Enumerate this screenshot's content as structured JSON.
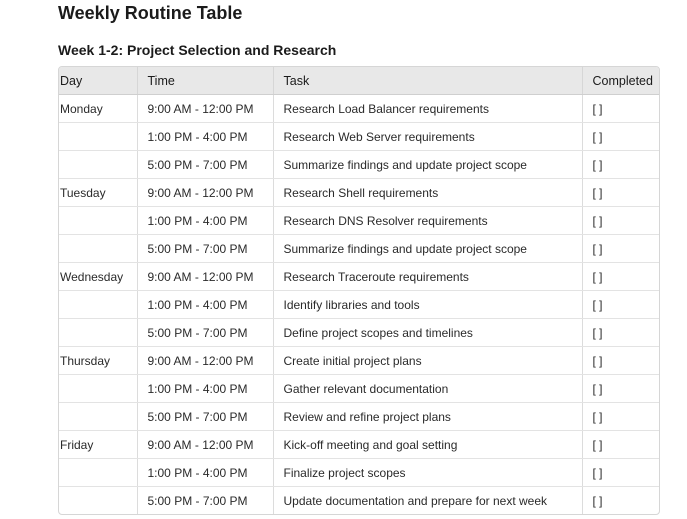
{
  "page": {
    "title": "Weekly Routine Table",
    "section_title": "Week 1-2: Project Selection and Research"
  },
  "table": {
    "headers": {
      "day": "Day",
      "time": "Time",
      "task": "Task",
      "completed": "Completed"
    },
    "rows": [
      {
        "day": "Monday",
        "time": "9:00 AM - 12:00 PM",
        "task": "Research Load Balancer requirements",
        "completed": "[ ]"
      },
      {
        "day": "",
        "time": "1:00 PM - 4:00 PM",
        "task": "Research Web Server requirements",
        "completed": "[ ]"
      },
      {
        "day": "",
        "time": "5:00 PM - 7:00 PM",
        "task": "Summarize findings and update project scope",
        "completed": "[ ]"
      },
      {
        "day": "Tuesday",
        "time": "9:00 AM - 12:00 PM",
        "task": "Research Shell requirements",
        "completed": "[ ]"
      },
      {
        "day": "",
        "time": "1:00 PM - 4:00 PM",
        "task": "Research DNS Resolver requirements",
        "completed": "[ ]"
      },
      {
        "day": "",
        "time": "5:00 PM - 7:00 PM",
        "task": "Summarize findings and update project scope",
        "completed": "[ ]"
      },
      {
        "day": "Wednesday",
        "time": "9:00 AM - 12:00 PM",
        "task": "Research Traceroute requirements",
        "completed": "[ ]"
      },
      {
        "day": "",
        "time": "1:00 PM - 4:00 PM",
        "task": "Identify libraries and tools",
        "completed": "[ ]"
      },
      {
        "day": "",
        "time": "5:00 PM - 7:00 PM",
        "task": "Define project scopes and timelines",
        "completed": "[ ]"
      },
      {
        "day": "Thursday",
        "time": "9:00 AM - 12:00 PM",
        "task": "Create initial project plans",
        "completed": "[ ]"
      },
      {
        "day": "",
        "time": "1:00 PM - 4:00 PM",
        "task": "Gather relevant documentation",
        "completed": "[ ]"
      },
      {
        "day": "",
        "time": "5:00 PM - 7:00 PM",
        "task": "Review and refine project plans",
        "completed": "[ ]"
      },
      {
        "day": "Friday",
        "time": "9:00 AM - 12:00 PM",
        "task": "Kick-off meeting and goal setting",
        "completed": "[ ]"
      },
      {
        "day": "",
        "time": "1:00 PM - 4:00 PM",
        "task": "Finalize project scopes",
        "completed": "[ ]"
      },
      {
        "day": "",
        "time": "5:00 PM - 7:00 PM",
        "task": "Update documentation and prepare for next week",
        "completed": "[ ]"
      }
    ]
  }
}
